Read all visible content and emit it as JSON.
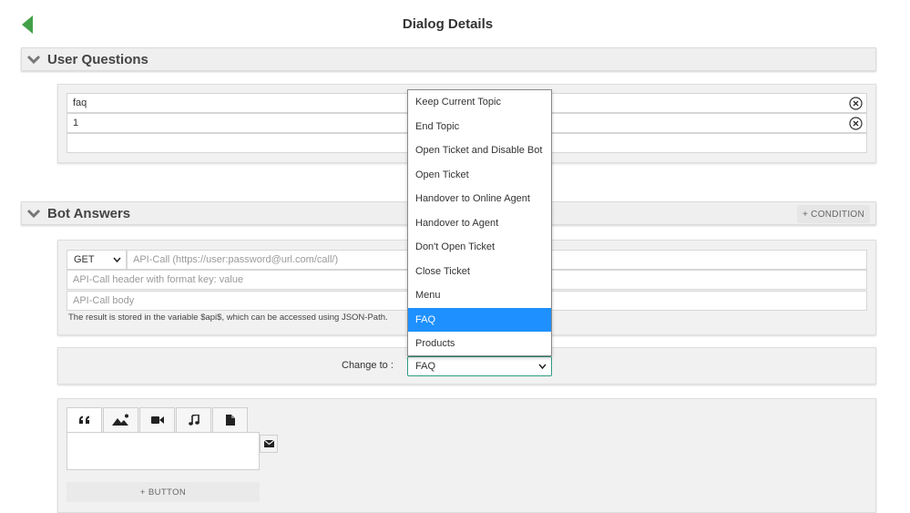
{
  "header": {
    "title": "Dialog Details",
    "back_color": "#43a047"
  },
  "user_questions": {
    "title": "User Questions",
    "questions": [
      "faq",
      "1",
      ""
    ]
  },
  "bot_answers": {
    "title": "Bot Answers",
    "condition_label": "+ CONDITION",
    "api": {
      "method": "GET",
      "url_placeholder": "API-Call (https://user:password@url.com/call/)",
      "header_placeholder": "API-Call header with format key: value",
      "body_placeholder": "API-Call body",
      "note": "The result is stored in the variable $api$, which can be accessed using JSON-Path."
    }
  },
  "change_to": {
    "label": "Change to :",
    "selected": "FAQ",
    "accent_color": "#2f9c83",
    "options": [
      "Keep Current Topic",
      "End Topic",
      "Open Ticket and Disable Bot",
      "Open Ticket",
      "Handover to Online Agent",
      "Handover to Agent",
      "Don't Open Ticket",
      "Close Ticket",
      "Menu",
      "FAQ",
      "Products"
    ],
    "highlight_color": "#1e90ff"
  },
  "message_editor": {
    "tabs": [
      "quote-icon",
      "image-icon",
      "video-icon",
      "music-icon",
      "file-icon"
    ],
    "side_icon": "envelope-icon",
    "add_button_label": "+ BUTTON"
  }
}
